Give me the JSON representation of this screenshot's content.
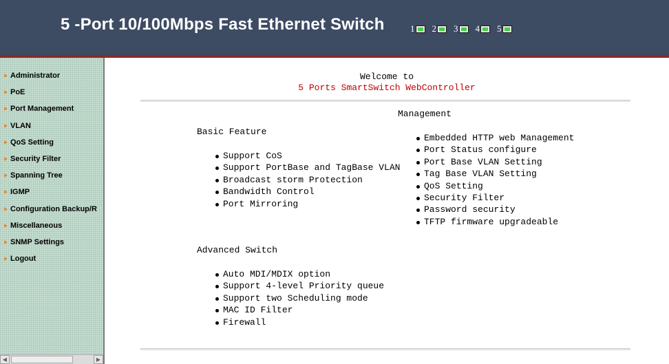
{
  "header": {
    "title": "5 -Port 10/100Mbps Fast Ethernet Switch",
    "ports": [
      {
        "label": "1",
        "status": "up"
      },
      {
        "label": "2",
        "status": "up"
      },
      {
        "label": "3",
        "status": "up"
      },
      {
        "label": "4",
        "status": "up"
      },
      {
        "label": "5",
        "status": "up"
      }
    ],
    "colors": {
      "background": "#3d4b63",
      "accent_border": "#8b2a2a",
      "led_on": "#3fd23f"
    }
  },
  "sidebar": {
    "items": [
      {
        "label": "Administrator"
      },
      {
        "label": "PoE"
      },
      {
        "label": "Port Management"
      },
      {
        "label": "VLAN"
      },
      {
        "label": "QoS Setting"
      },
      {
        "label": "Security Filter"
      },
      {
        "label": "Spanning Tree"
      },
      {
        "label": "IGMP"
      },
      {
        "label": "Configuration Backup/R"
      },
      {
        "label": "Miscellaneous"
      },
      {
        "label": "SNMP Settings"
      },
      {
        "label": "Logout"
      }
    ],
    "bullet_icon": "orange-arrow-icon"
  },
  "main": {
    "welcome": "Welcome to",
    "product": "5 Ports SmartSwitch WebController",
    "management_heading": "Management",
    "basic": {
      "heading": "Basic Feature",
      "items": [
        "Support CoS",
        "Support PortBase and TagBase VLAN",
        "Broadcast storm Protection",
        "Bandwidth Control",
        "Port Mirroring"
      ]
    },
    "management": {
      "items": [
        "Embedded HTTP web Management",
        "Port Status configure",
        "Port Base VLAN Setting",
        "Tag Base VLAN Setting",
        "QoS Setting",
        "Security Filter",
        "Password security",
        "TFTP firmware upgradeable"
      ]
    },
    "advanced": {
      "heading": "Advanced Switch",
      "items": [
        "Auto MDI/MDIX option",
        "Support 4-level Priority queue",
        "Support two Scheduling mode",
        "MAC ID Filter",
        "Firewall"
      ]
    }
  }
}
